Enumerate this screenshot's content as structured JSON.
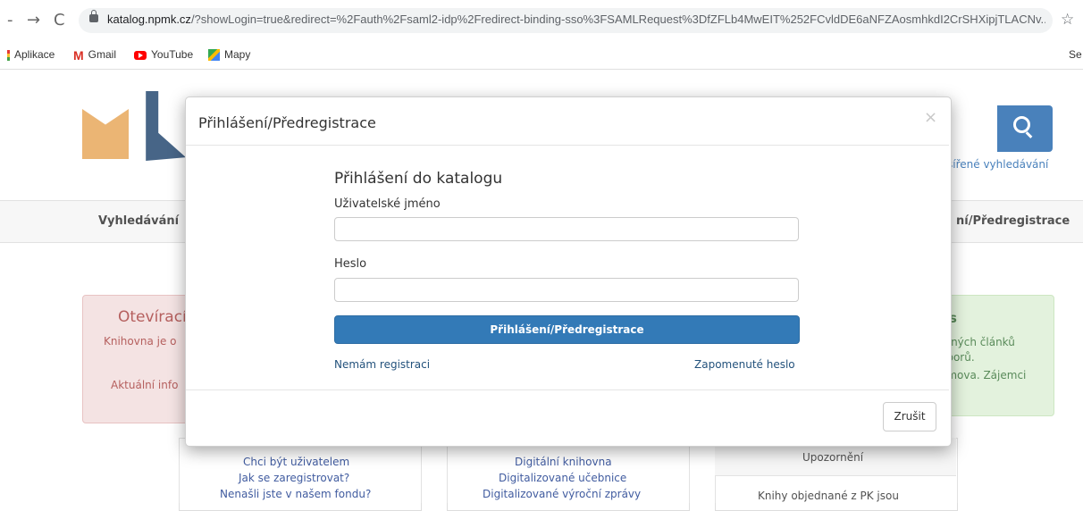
{
  "browser": {
    "url_domain": "katalog.npmk.cz",
    "url_rest": "/?showLogin=true&redirect=%2Fauth%2Fsaml2-idp%2Fredirect-binding-sso%3FSAMLRequest%3DfZFLb4MwEIT%252FCvldDE6aNFZAosmhkdI2CrSHXipjTLACNv...",
    "bookmarks": [
      "Aplikace",
      "Gmail",
      "YouTube",
      "Mapy"
    ],
    "bookmark_right": "Se"
  },
  "page": {
    "adv_search": "šířené vyhledávání",
    "menu_left": "Vyhledávání",
    "menu_right": "ní/Předregistrace",
    "red_box": {
      "title": "Otevírací",
      "line1": "Knihovna je o",
      "line2": "Aktuální info"
    },
    "green_box": {
      "title": "s",
      "line1": "orných článků",
      "line2": "oborů.",
      "line3": "omova. Zájemci"
    },
    "panel1_links": [
      "Chci být uživatelem",
      "Jak se zaregistrovat?",
      "Nenašli jste v našem fondu?"
    ],
    "panel2_links": [
      "Digitální knihovna",
      "Digitalizované učebnice",
      "Digitalizované výroční zprávy"
    ],
    "panel3_head": "Upozornění",
    "panel3_text": "Knihy objednané z PK jsou"
  },
  "modal": {
    "title": "Přihlášení/Předregistrace",
    "close": "×",
    "form_title": "Přihlášení do katalogu",
    "username_label": "Uživatelské jméno",
    "username_value": "",
    "password_label": "Heslo",
    "password_value": "",
    "login_button": "Přihlášení/Předregistrace",
    "register_link": "Nemám registraci",
    "forgot_link": "Zapomenuté heslo",
    "cancel_button": "Zrušit"
  }
}
